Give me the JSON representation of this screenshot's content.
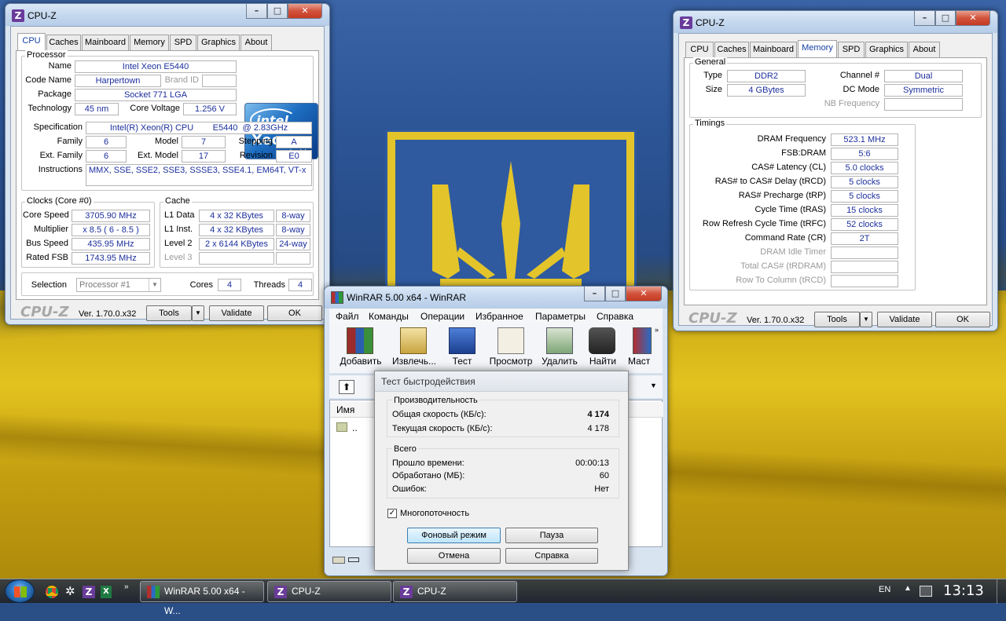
{
  "colors": {
    "flag_blue": "#2d5698",
    "flag_yellow": "#e2c21f",
    "cpuz_value": "#1c2f9c",
    "cpuz_active_tab": "#1640a8"
  },
  "cpuz_left": {
    "title": "CPU-Z",
    "tabs": [
      "CPU",
      "Caches",
      "Mainboard",
      "Memory",
      "SPD",
      "Graphics",
      "About"
    ],
    "active_tab": "CPU",
    "processor": {
      "group": "Processor",
      "name_label": "Name",
      "name": "Intel Xeon E5440",
      "codename_label": "Code Name",
      "codename": "Harpertown",
      "brand_id_label": "Brand ID",
      "package_label": "Package",
      "package": "Socket 771 LGA",
      "technology_label": "Technology",
      "technology": "45 nm",
      "core_voltage_label": "Core Voltage",
      "core_voltage": "1.256 V",
      "specification_label": "Specification",
      "specification": "Intel(R) Xeon(R) CPU        E5440  @ 2.83GHz",
      "family_label": "Family",
      "family": "6",
      "model_label": "Model",
      "model": "7",
      "stepping_label": "Stepping",
      "stepping": "A",
      "ext_family_label": "Ext. Family",
      "ext_family": "6",
      "ext_model_label": "Ext. Model",
      "ext_model": "17",
      "revision_label": "Revision",
      "revision": "E0",
      "instructions_label": "Instructions",
      "instructions": "MMX, SSE, SSE2, SSE3, SSSE3, SSE4.1, EM64T, VT-x"
    },
    "intel_logo": {
      "brand": "intel",
      "product": "Xeon",
      "tag": "inside"
    },
    "clocks": {
      "group": "Clocks (Core #0)",
      "core_speed_label": "Core Speed",
      "core_speed": "3705.90 MHz",
      "multiplier_label": "Multiplier",
      "multiplier": "x 8.5 ( 6 - 8.5 )",
      "bus_speed_label": "Bus Speed",
      "bus_speed": "435.95 MHz",
      "rated_fsb_label": "Rated FSB",
      "rated_fsb": "1743.95 MHz"
    },
    "cache": {
      "group": "Cache",
      "l1_data_label": "L1 Data",
      "l1_data": "4 x 32 KBytes",
      "l1_data_way": "8-way",
      "l1_inst_label": "L1 Inst.",
      "l1_inst": "4 x 32 KBytes",
      "l1_inst_way": "8-way",
      "level2_label": "Level 2",
      "level2": "2 x 6144 KBytes",
      "level2_way": "24-way",
      "level3_label": "Level 3"
    },
    "selection_label": "Selection",
    "selection": "Processor #1",
    "cores_label": "Cores",
    "cores": "4",
    "threads_label": "Threads",
    "threads": "4",
    "brand": "CPU-Z",
    "version": "Ver. 1.70.0.x32",
    "tools": "Tools",
    "validate": "Validate",
    "ok": "OK"
  },
  "cpuz_right": {
    "title": "CPU-Z",
    "tabs": [
      "CPU",
      "Caches",
      "Mainboard",
      "Memory",
      "SPD",
      "Graphics",
      "About"
    ],
    "active_tab": "Memory",
    "general": {
      "group": "General",
      "type_label": "Type",
      "type": "DDR2",
      "size_label": "Size",
      "size": "4 GBytes",
      "channel_label": "Channel #",
      "channel": "Dual",
      "dc_mode_label": "DC Mode",
      "dc_mode": "Symmetric",
      "nb_freq_label": "NB Frequency"
    },
    "timings": {
      "group": "Timings",
      "rows": [
        {
          "label": "DRAM Frequency",
          "value": "523.1 MHz",
          "disabled": false
        },
        {
          "label": "FSB:DRAM",
          "value": "5:6",
          "disabled": false
        },
        {
          "label": "CAS# Latency (CL)",
          "value": "5.0 clocks",
          "disabled": false
        },
        {
          "label": "RAS# to CAS# Delay (tRCD)",
          "value": "5 clocks",
          "disabled": false
        },
        {
          "label": "RAS# Precharge (tRP)",
          "value": "5 clocks",
          "disabled": false
        },
        {
          "label": "Cycle Time (tRAS)",
          "value": "15 clocks",
          "disabled": false
        },
        {
          "label": "Row Refresh Cycle Time (tRFC)",
          "value": "52 clocks",
          "disabled": false
        },
        {
          "label": "Command Rate (CR)",
          "value": "2T",
          "disabled": false
        },
        {
          "label": "DRAM Idle Timer",
          "value": "",
          "disabled": true
        },
        {
          "label": "Total CAS# (tRDRAM)",
          "value": "",
          "disabled": true
        },
        {
          "label": "Row To Column (tRCD)",
          "value": "",
          "disabled": true
        }
      ]
    },
    "brand": "CPU-Z",
    "version": "Ver. 1.70.0.x32",
    "tools": "Tools",
    "validate": "Validate",
    "ok": "OK"
  },
  "winrar": {
    "title": "WinRAR 5.00 x64 - WinRAR",
    "menu": [
      "Файл",
      "Команды",
      "Операции",
      "Избранное",
      "Параметры",
      "Справка"
    ],
    "toolbar": [
      "Добавить",
      "Извлечь...",
      "Тест",
      "Просмотр",
      "Удалить",
      "Найти",
      "Маст"
    ],
    "column_name": "Имя",
    "parent_dir": ".."
  },
  "benchmark": {
    "title": "Тест быстродействия",
    "performance": {
      "group": "Производительность",
      "total_speed_label": "Общая скорость (КБ/с):",
      "total_speed": "4 174",
      "current_speed_label": "Текущая скорость (КБ/с):",
      "current_speed": "4 178"
    },
    "total": {
      "group": "Всего",
      "elapsed_label": "Прошло времени:",
      "elapsed": "00:00:13",
      "processed_label": "Обработано (МБ):",
      "processed": "60",
      "errors_label": "Ошибок:",
      "errors": "Нет"
    },
    "multithreading_label": "Многопоточность",
    "multithreading": true,
    "background_button": "Фоновый режим",
    "pause_button": "Пауза",
    "cancel_button": "Отмена",
    "help_button": "Справка"
  },
  "taskbar": {
    "tasks": [
      "WinRAR 5.00 x64 - W...",
      "CPU-Z",
      "CPU-Z"
    ],
    "language": "EN",
    "time": "13:13"
  }
}
